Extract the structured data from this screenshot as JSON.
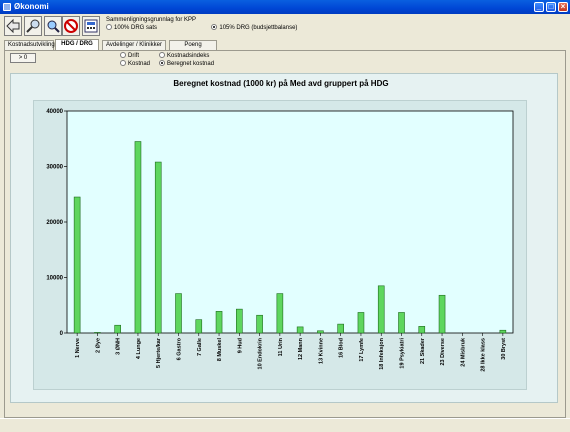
{
  "window": {
    "title": "Økonomi"
  },
  "toolbar": {
    "icons": [
      "back-arrow-icon",
      "magnifier-icon",
      "zoom-icon",
      "stop-icon",
      "calculator-icon"
    ]
  },
  "basis": {
    "label": "Sammenligningsgrunnlag for KPP",
    "option1": "100% DRG sats",
    "option2": "105% DRG (budsjettbalanse)",
    "selected": "option2"
  },
  "tabs": [
    "Kostnadsutvikling",
    "HDG / DRG",
    "Avdelinger / Klinikker",
    "Poeng Opphold"
  ],
  "active_tab": "HDG / DRG",
  "panel": {
    "goto_button": "> 0",
    "opt_a1": "Drift",
    "opt_a2": "Kostnad",
    "opt_b1": "Kostnadsindeks",
    "opt_b2": "Beregnet kostnad"
  },
  "chart_data": {
    "type": "bar",
    "title": "Beregnet kostnad (1000 kr)  på Med avd gruppert på HDG",
    "xlabel": "",
    "ylabel": "",
    "ylim": [
      0,
      40000
    ],
    "yticks": [
      "0",
      "10000",
      "20000",
      "30000",
      "40000"
    ],
    "categories": [
      "1 Nerve",
      "2 Øye",
      "3 ØNH",
      "4 Lunge",
      "5 Hjerte/kar",
      "6 Gastro",
      "7 Galle",
      "8 Muskel",
      "9 Hud",
      "10 Endokrin",
      "11 Urin",
      "12 Mann",
      "13 Kvinne",
      "16 Blod",
      "17 Lymfe",
      "18 Infeksjon",
      "19 Psykiatri",
      "21 Skader",
      "23 Diverse",
      "24 Misbruk",
      "28 Ikke klass",
      "30 Bryst"
    ],
    "values": [
      24500,
      100,
      1400,
      34500,
      30800,
      7100,
      2400,
      3900,
      4300,
      3200,
      7100,
      1100,
      400,
      1600,
      3700,
      8500,
      3700,
      1200,
      6800,
      0,
      0,
      500
    ],
    "color": "#5ED65E",
    "grid": false,
    "legend": "none"
  }
}
